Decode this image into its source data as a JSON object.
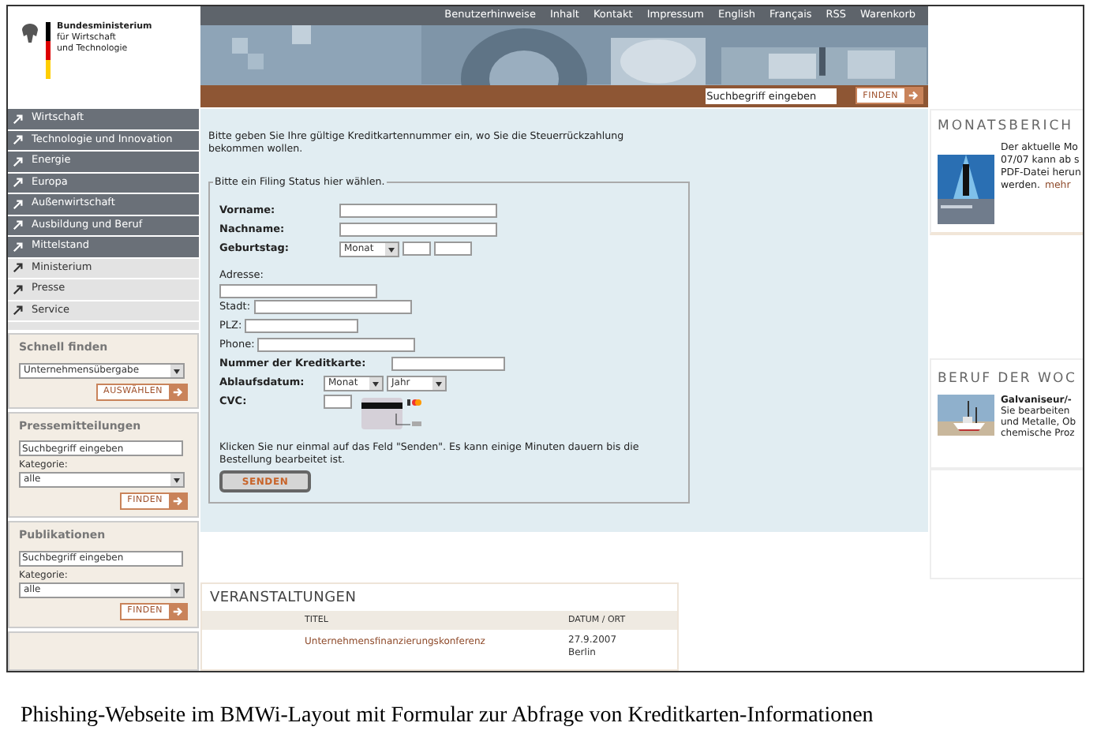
{
  "logo": {
    "lines": [
      "Bundesministerium",
      "für Wirtschaft",
      "und Technologie"
    ]
  },
  "top_links": [
    "Benutzerhinweise",
    "Inhalt",
    "Kontakt",
    "Impressum",
    "English",
    "Français",
    "RSS",
    "Warenkorb"
  ],
  "header_search": {
    "value": "Suchbegriff eingeben",
    "button": "FINDEN"
  },
  "nav": [
    {
      "label": "Wirtschaft",
      "kind": "primary"
    },
    {
      "label": "Technologie und Innovation",
      "kind": "primary"
    },
    {
      "label": "Energie",
      "kind": "primary"
    },
    {
      "label": "Europa",
      "kind": "primary"
    },
    {
      "label": "Außenwirtschaft",
      "kind": "primary"
    },
    {
      "label": "Ausbildung und Beruf",
      "kind": "primary"
    },
    {
      "label": "Mittelstand",
      "kind": "primary"
    },
    {
      "label": "Ministerium",
      "kind": "secondary"
    },
    {
      "label": "Presse",
      "kind": "secondary"
    },
    {
      "label": "Service",
      "kind": "secondary"
    }
  ],
  "sidebar_boxes": [
    {
      "kind": "select",
      "title": "Schnell finden",
      "select_value": "Unternehmensübergabe",
      "button": "AUSWÄHLEN"
    },
    {
      "kind": "search",
      "title": "Pressemitteilungen",
      "search_value": "Suchbegriff eingeben",
      "category_label": "Kategorie:",
      "select_value": "alle",
      "button": "FINDEN"
    },
    {
      "kind": "search",
      "title": "Publikationen",
      "search_value": "Suchbegriff eingeben",
      "category_label": "Kategorie:",
      "select_value": "alle",
      "button": "FINDEN"
    }
  ],
  "intro": "Bitte geben Sie Ihre gültige Kreditkartennummer ein, wo Sie die Steuerrückzahlung bekommen wollen.",
  "form": {
    "legend": "Bitte ein Filing Status hier wählen.",
    "fields": [
      {
        "label": "Vorname:",
        "kind": "aligned",
        "bold": true,
        "controls": [
          {
            "kind": "long"
          }
        ]
      },
      {
        "label": "Nachname:",
        "kind": "aligned",
        "bold": true,
        "controls": [
          {
            "kind": "long"
          }
        ]
      },
      {
        "label": "Geburtstag:",
        "kind": "aligned",
        "bold": true,
        "controls": [
          {
            "kind": "select",
            "value": "Monat"
          },
          {
            "kind": "tiny"
          },
          {
            "kind": "small"
          }
        ]
      },
      {
        "label": "Adresse:",
        "kind": "stacked",
        "bold": false,
        "controls": [
          {
            "kind": "medium"
          }
        ]
      },
      {
        "label": "Stadt:",
        "kind": "inline",
        "bold": false,
        "controls": [
          {
            "kind": "medium"
          }
        ]
      },
      {
        "label": "PLZ:",
        "kind": "inline",
        "bold": false,
        "controls": [
          {
            "kind": "short"
          }
        ]
      },
      {
        "label": "Phone:",
        "kind": "inline",
        "bold": false,
        "controls": [
          {
            "kind": "medium"
          }
        ]
      },
      {
        "label": "Nummer der Kreditkarte:",
        "kind": "inline",
        "bold": true,
        "controls": [
          {
            "kind": "short"
          }
        ]
      },
      {
        "label": "Ablaufsdatum:",
        "kind": "inline",
        "bold": true,
        "controls": [
          {
            "kind": "select",
            "value": "Monat"
          },
          {
            "kind": "select",
            "value": "Jahr"
          }
        ]
      },
      {
        "label": "CVC:",
        "kind": "inline",
        "bold": true,
        "controls": [
          {
            "kind": "tiny"
          },
          {
            "kind": "card"
          }
        ]
      }
    ],
    "note": "Klicken Sie nur einmal auf das Feld \"Senden\". Es kann einige Minuten dauern bis die Bestellung bearbeitet ist.",
    "button": "SENDEN"
  },
  "events": {
    "title": "VERANSTALTUNGEN",
    "columns": [
      "TITEL",
      "DATUM / ORT"
    ],
    "rows": [
      {
        "title": "Unternehmensfinanzierungskonferenz",
        "date": "27.9.2007",
        "place": "Berlin"
      }
    ]
  },
  "monatsbericht": {
    "title": "MONATSBERICH",
    "lines": [
      "Der aktuelle Mo",
      "07/07 kann ab s",
      "PDF-Datei herun"
    ],
    "last": "werden.",
    "link": "mehr"
  },
  "beruf": {
    "title": "BERUF DER WOC",
    "heading": "Galvaniseur/-",
    "lines": [
      "Sie bearbeiten",
      "und Metalle, Ob",
      "chemische Proz"
    ]
  },
  "caption": "Phishing-Webseite im BMWi-Layout mit Formular zur Abfrage von Kreditkarten-Informationen"
}
